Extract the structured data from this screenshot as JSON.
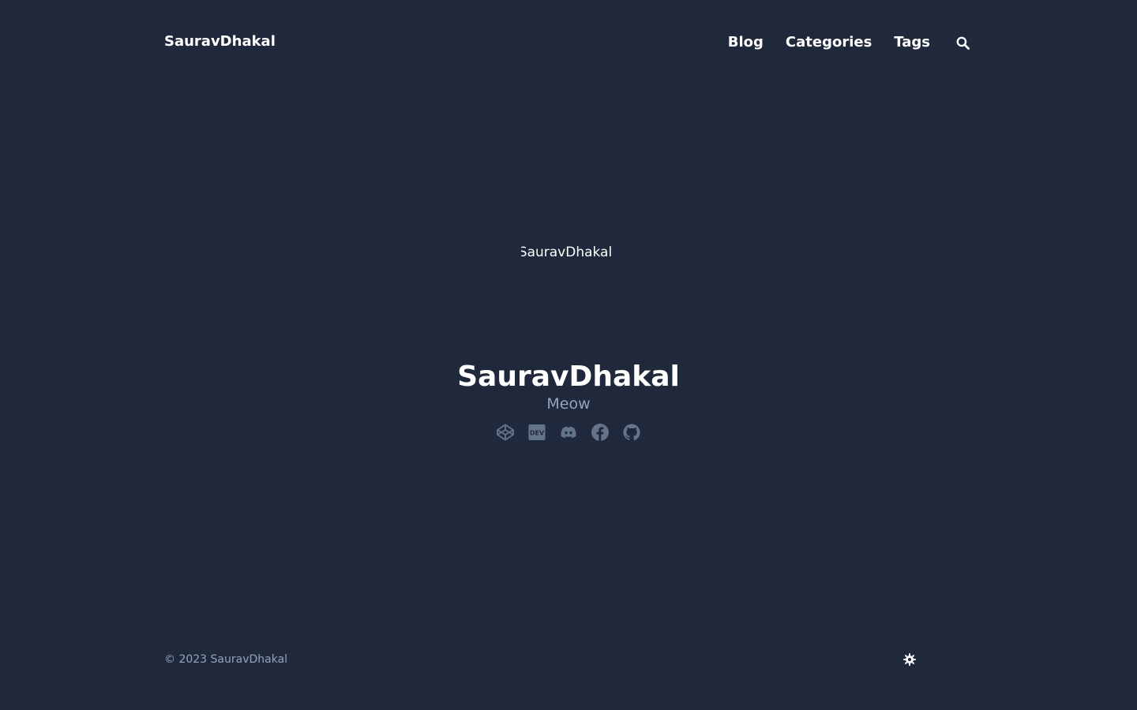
{
  "header": {
    "site_title": "SauravDhakal",
    "nav": {
      "blog": "Blog",
      "categories": "Categories",
      "tags": "Tags"
    },
    "search_icon": "search-icon"
  },
  "profile": {
    "avatar_alt": "SauravDhakal",
    "name": "SauravDhakal",
    "subtitle": "Meow",
    "social_icons": [
      "codepen-icon",
      "dev-icon",
      "discord-icon",
      "facebook-icon",
      "github-icon"
    ]
  },
  "footer": {
    "copyright": "© 2023 SauravDhakal",
    "theme_icon": "sun-icon"
  },
  "colors": {
    "background": "#1f293b",
    "text": "#ffffff",
    "muted": "#94a3b8",
    "social_icon": "#64748b"
  }
}
